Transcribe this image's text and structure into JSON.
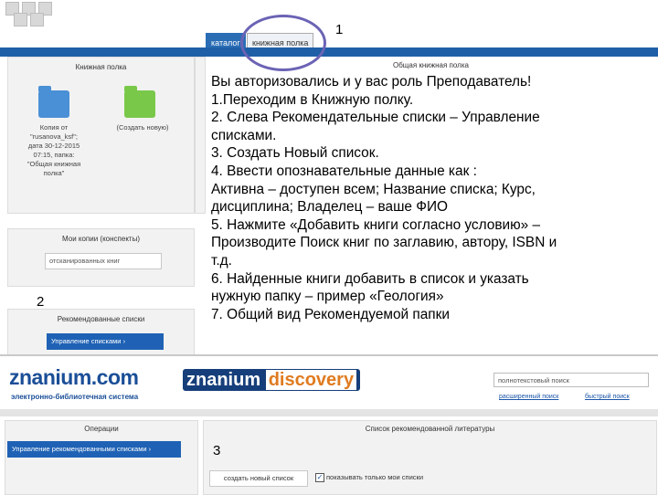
{
  "header": {
    "tab_catalog": "каталог",
    "tab_bookshelf": "книжная полка"
  },
  "markers": {
    "one": "1",
    "two": "2",
    "three": "3"
  },
  "left_panels": {
    "bookshelf_title": "Книжная полка",
    "folder1_lines": [
      "Копия от",
      "\"rusanova_ksf\";",
      "дата 30-12-2015",
      "07:15, папка:",
      "\"Общая книжная",
      "полка\""
    ],
    "folder2_label": "(Создать новую)",
    "copies_title": "Мои копии (конспекты)",
    "copies_field": "отсканированных книг",
    "recommended_title": "Рекомендованные списки",
    "manage_lists_button": "Управление списками"
  },
  "right_panel_title": "Общая книжная полка",
  "instructions": [
    "Вы авторизовались и у вас роль Преподаватель!",
    "1.Переходим в Книжную полку.",
    "2. Слева Рекомендательные списки – Управление",
    "списками.",
    "3. Создать Новый список.",
    "4. Ввести опознавательные данные как :",
    "Активна – доступен всем; Название списка; Курс,",
    "дисциплина; Владелец – ваше ФИО",
    "5. Нажмите «Добавить книги согласно условию» –",
    "Производите Поиск книг по заглавию, автору, ISBN и",
    "т.д.",
    "6. Найденные книги добавить в список и указать",
    "нужную папку – пример «Геология»",
    "7. Общий вид Рекомендуемой папки"
  ],
  "bottom": {
    "logo_znanium": "znanium.com",
    "logo_sub": "электронно-библиотечная система",
    "logo_discovery_main": "znanium",
    "logo_discovery_tail": "discovery",
    "search_placeholder": "полнотекстовый поиск",
    "link_advanced": "расширенный поиск",
    "link_quick": "быстрый поиск",
    "operations_title": "Операции",
    "manage_recommended_button": "Управление рекомендованными списками",
    "list_panel_title": "Список рекомендованной литературы",
    "create_list_button": "создать новый список",
    "show_mine_label": "показывать только мои списки"
  }
}
